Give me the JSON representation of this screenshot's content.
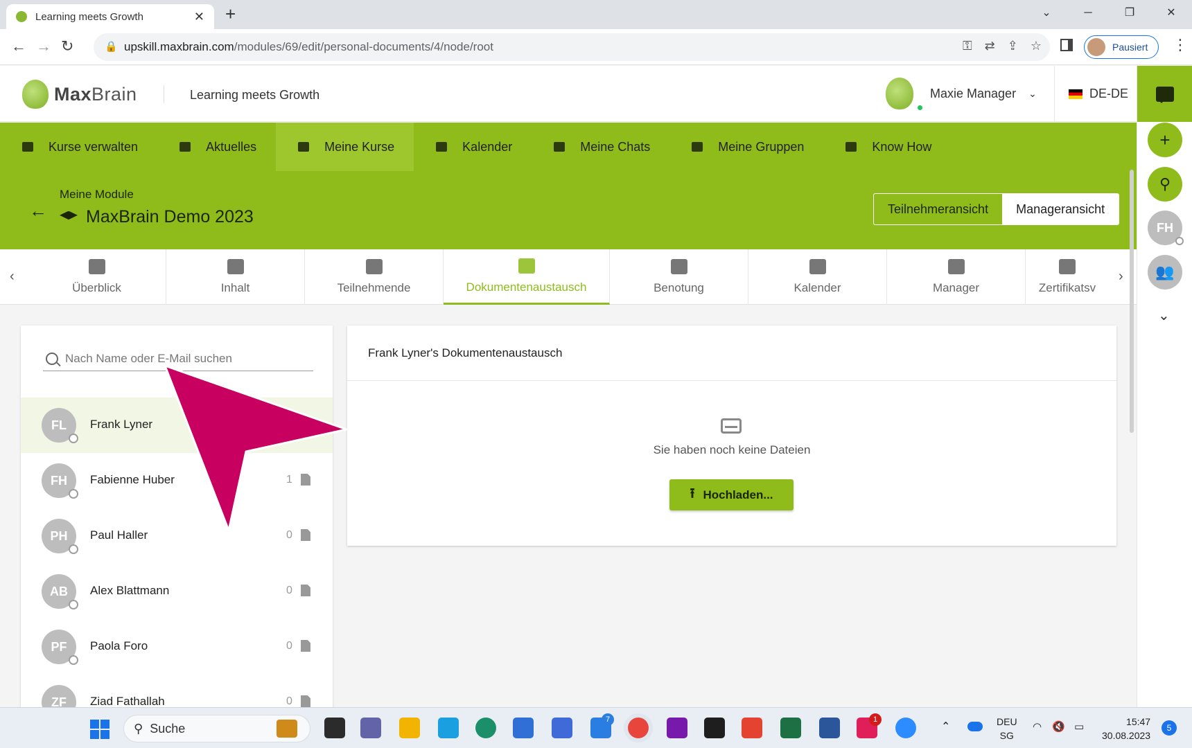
{
  "browser": {
    "tab_title": "Learning meets Growth",
    "url_host": "upskill.maxbrain.com",
    "url_path": "/modules/69/edit/personal-documents/4/node/root",
    "profile_label": "Pausiert"
  },
  "header": {
    "brand_bold": "Max",
    "brand_light": "Brain",
    "tagline": "Learning meets Growth",
    "user_name": "Maxie Manager",
    "language": "DE-DE"
  },
  "main_nav": [
    {
      "label": "Kurse verwalten",
      "active": false
    },
    {
      "label": "Aktuelles",
      "active": false
    },
    {
      "label": "Meine Kurse",
      "active": true
    },
    {
      "label": "Kalender",
      "active": false
    },
    {
      "label": "Meine Chats",
      "active": false
    },
    {
      "label": "Meine Gruppen",
      "active": false
    },
    {
      "label": "Know How",
      "active": false
    }
  ],
  "module": {
    "breadcrumb": "Meine Module",
    "title": "MaxBrain Demo 2023",
    "view_participant": "Teilnehmeransicht",
    "view_manager": "Manageransicht"
  },
  "tabs": [
    {
      "label": "Überblick"
    },
    {
      "label": "Inhalt"
    },
    {
      "label": "Teilnehmende"
    },
    {
      "label": "Dokumentenaustausch",
      "active": true
    },
    {
      "label": "Benotung"
    },
    {
      "label": "Kalender"
    },
    {
      "label": "Manager"
    },
    {
      "label": "Zertifikatsv"
    }
  ],
  "participants": {
    "search_placeholder": "Nach Name oder E-Mail suchen",
    "items": [
      {
        "initials": "FL",
        "name": "Frank Lyner",
        "count": "",
        "selected": true
      },
      {
        "initials": "FH",
        "name": "Fabienne Huber",
        "count": "1"
      },
      {
        "initials": "PH",
        "name": "Paul Haller",
        "count": "0"
      },
      {
        "initials": "AB",
        "name": "Alex Blattmann",
        "count": "0"
      },
      {
        "initials": "PF",
        "name": "Paola Foro",
        "count": "0"
      },
      {
        "initials": "ZF",
        "name": "Ziad Fathallah",
        "count": "0"
      }
    ]
  },
  "documents": {
    "title": "Frank Lyner's Dokumentenaustausch",
    "empty_text": "Sie haben noch keine Dateien",
    "upload_label": "Hochladen..."
  },
  "right_sidebar": {
    "avatar_initials": "FH"
  },
  "taskbar": {
    "search_label": "Suche",
    "lang_top": "DEU",
    "lang_bottom": "SG",
    "time": "15:47",
    "date": "30.08.2023",
    "notifications": "5",
    "badge_todo": "7",
    "badge_slack": "1"
  },
  "colors": {
    "brand_green": "#8fbc1b",
    "annotation_magenta": "#c8005f"
  }
}
